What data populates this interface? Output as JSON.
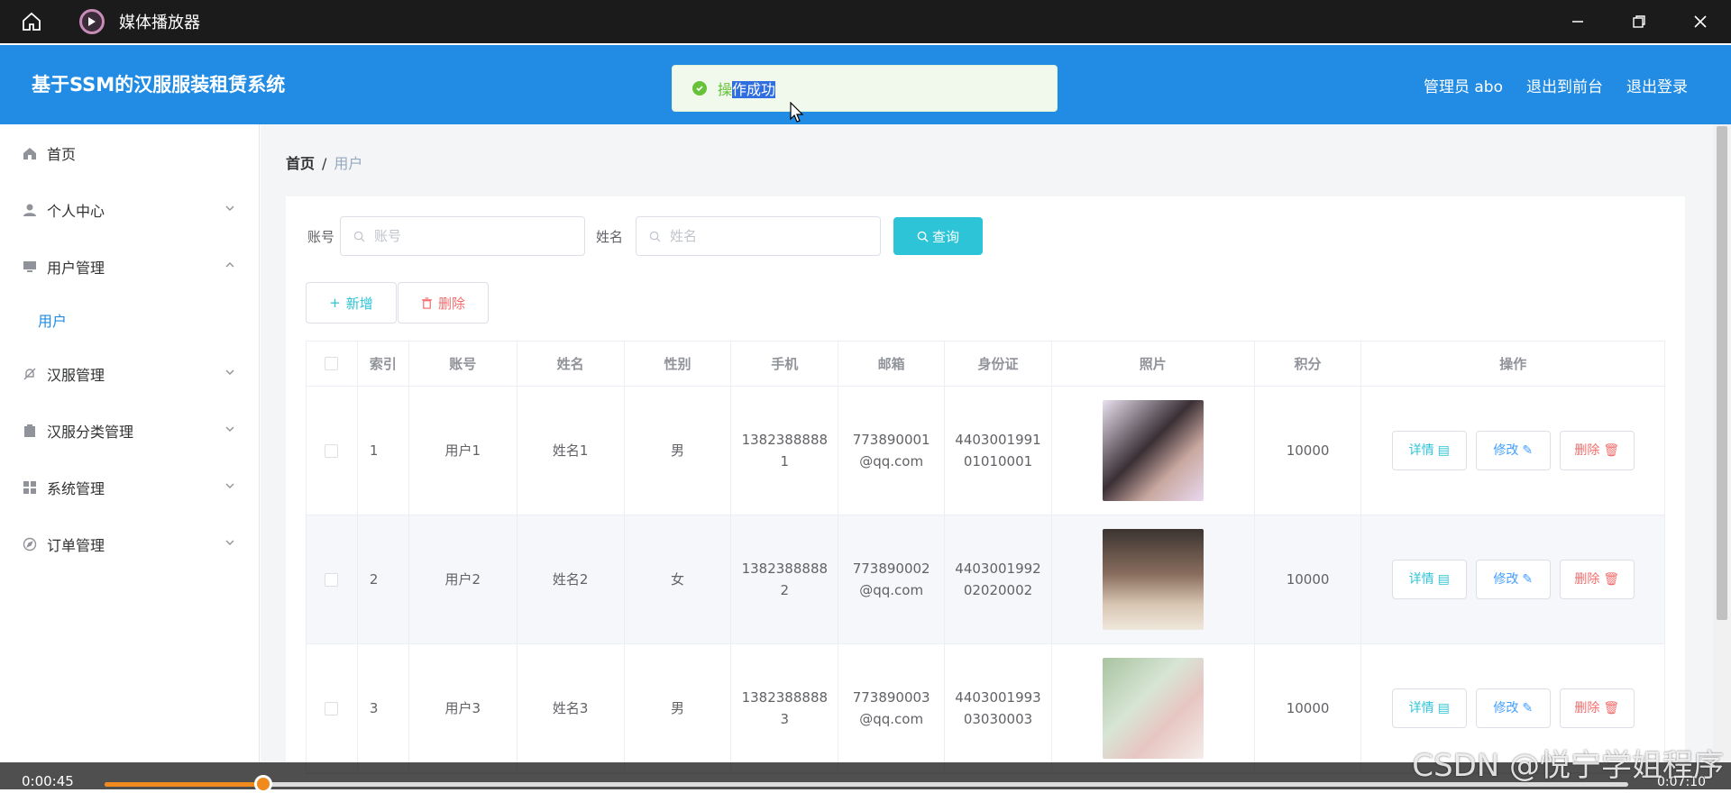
{
  "player": {
    "title": "媒体播放器",
    "time_current": "0:00:45",
    "time_total": "0:07:10",
    "progress": 0.104
  },
  "header": {
    "title": "基于SSM的汉服服装租赁系统",
    "links": [
      "管理员 abo",
      "退出到前台",
      "退出登录"
    ]
  },
  "toast": {
    "message_start": "操",
    "message_selected": "作成功"
  },
  "sidebar": {
    "items": [
      {
        "label": "首页",
        "icon": "home-icon"
      },
      {
        "label": "个人中心",
        "icon": "user-icon"
      },
      {
        "label": "用户管理",
        "icon": "monitor-icon"
      },
      {
        "label": "汉服管理",
        "icon": "bell-off-icon"
      },
      {
        "label": "汉服分类管理",
        "icon": "clipboard-icon"
      },
      {
        "label": "系统管理",
        "icon": "grid-icon"
      },
      {
        "label": "订单管理",
        "icon": "compass-icon"
      }
    ],
    "submenu": {
      "label": "用户"
    }
  },
  "breadcrumb": {
    "home": "首页",
    "separator": "/",
    "current": "用户"
  },
  "search": {
    "account_label": "账号",
    "account_placeholder": "账号",
    "name_label": "姓名",
    "name_placeholder": "姓名",
    "query_button": "查询"
  },
  "actions": {
    "add": "新增",
    "delete": "删除"
  },
  "table": {
    "headers": [
      "索引",
      "账号",
      "姓名",
      "性别",
      "手机",
      "邮箱",
      "身份证",
      "照片",
      "积分",
      "操作"
    ],
    "rows": [
      {
        "index": "1",
        "account": "用户1",
        "name": "姓名1",
        "gender": "男",
        "phone": "13823888881",
        "email": "773890001@qq.com",
        "id_card": "440300199101010001",
        "points": "10000"
      },
      {
        "index": "2",
        "account": "用户2",
        "name": "姓名2",
        "gender": "女",
        "phone": "13823888882",
        "email": "773890002@qq.com",
        "id_card": "440300199202020002",
        "points": "10000"
      },
      {
        "index": "3",
        "account": "用户3",
        "name": "姓名3",
        "gender": "男",
        "phone": "13823888883",
        "email": "773890003@qq.com",
        "id_card": "440300199303030003",
        "points": "10000"
      }
    ],
    "ops": {
      "detail": "详情",
      "edit": "修改",
      "remove": "删除"
    }
  },
  "watermark": "CSDN @悦宁学姐程序",
  "colors": {
    "header": "#228ce4",
    "accent": "#2dc4d7",
    "danger": "#f56c6c",
    "seek": "#f08a1c"
  }
}
